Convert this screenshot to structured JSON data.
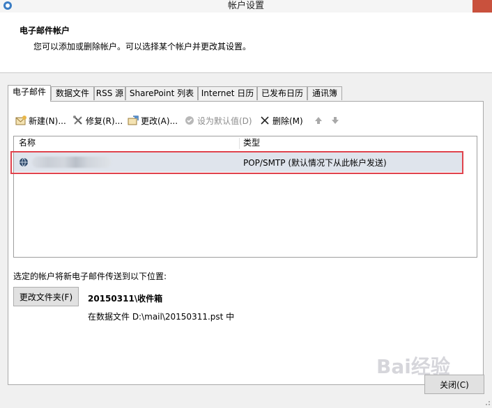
{
  "window": {
    "title": "帐户设置"
  },
  "header": {
    "title": "电子邮件帐户",
    "description": "您可以添加或删除帐户。可以选择某个帐户并更改其设置。"
  },
  "tabs": [
    {
      "label": "电子邮件"
    },
    {
      "label": "数据文件"
    },
    {
      "label": "RSS 源"
    },
    {
      "label": "SharePoint 列表"
    },
    {
      "label": "Internet 日历"
    },
    {
      "label": "已发布日历"
    },
    {
      "label": "通讯簿"
    }
  ],
  "toolbar": {
    "new": "新建(N)...",
    "repair": "修复(R)...",
    "change": "更改(A)...",
    "set_default": "设为默认值(D)",
    "remove": "删除(M)"
  },
  "account_list": {
    "columns": {
      "name": "名称",
      "type": "类型"
    },
    "rows": [
      {
        "type": "POP/SMTP (默认情况下从此帐户发送)"
      }
    ]
  },
  "delivery": {
    "label": "选定的帐户将新电子邮件传送到以下位置:",
    "change_folder": "更改文件夹(F)",
    "folder": "20150311\\收件箱",
    "path": "在数据文件 D:\\mail\\20150311.pst 中"
  },
  "footer": {
    "close": "关闭(C)"
  },
  "watermark": "Bai经验",
  "colors": {
    "highlight_border": "#e0424c",
    "selected_row": "#dfe4ec"
  }
}
